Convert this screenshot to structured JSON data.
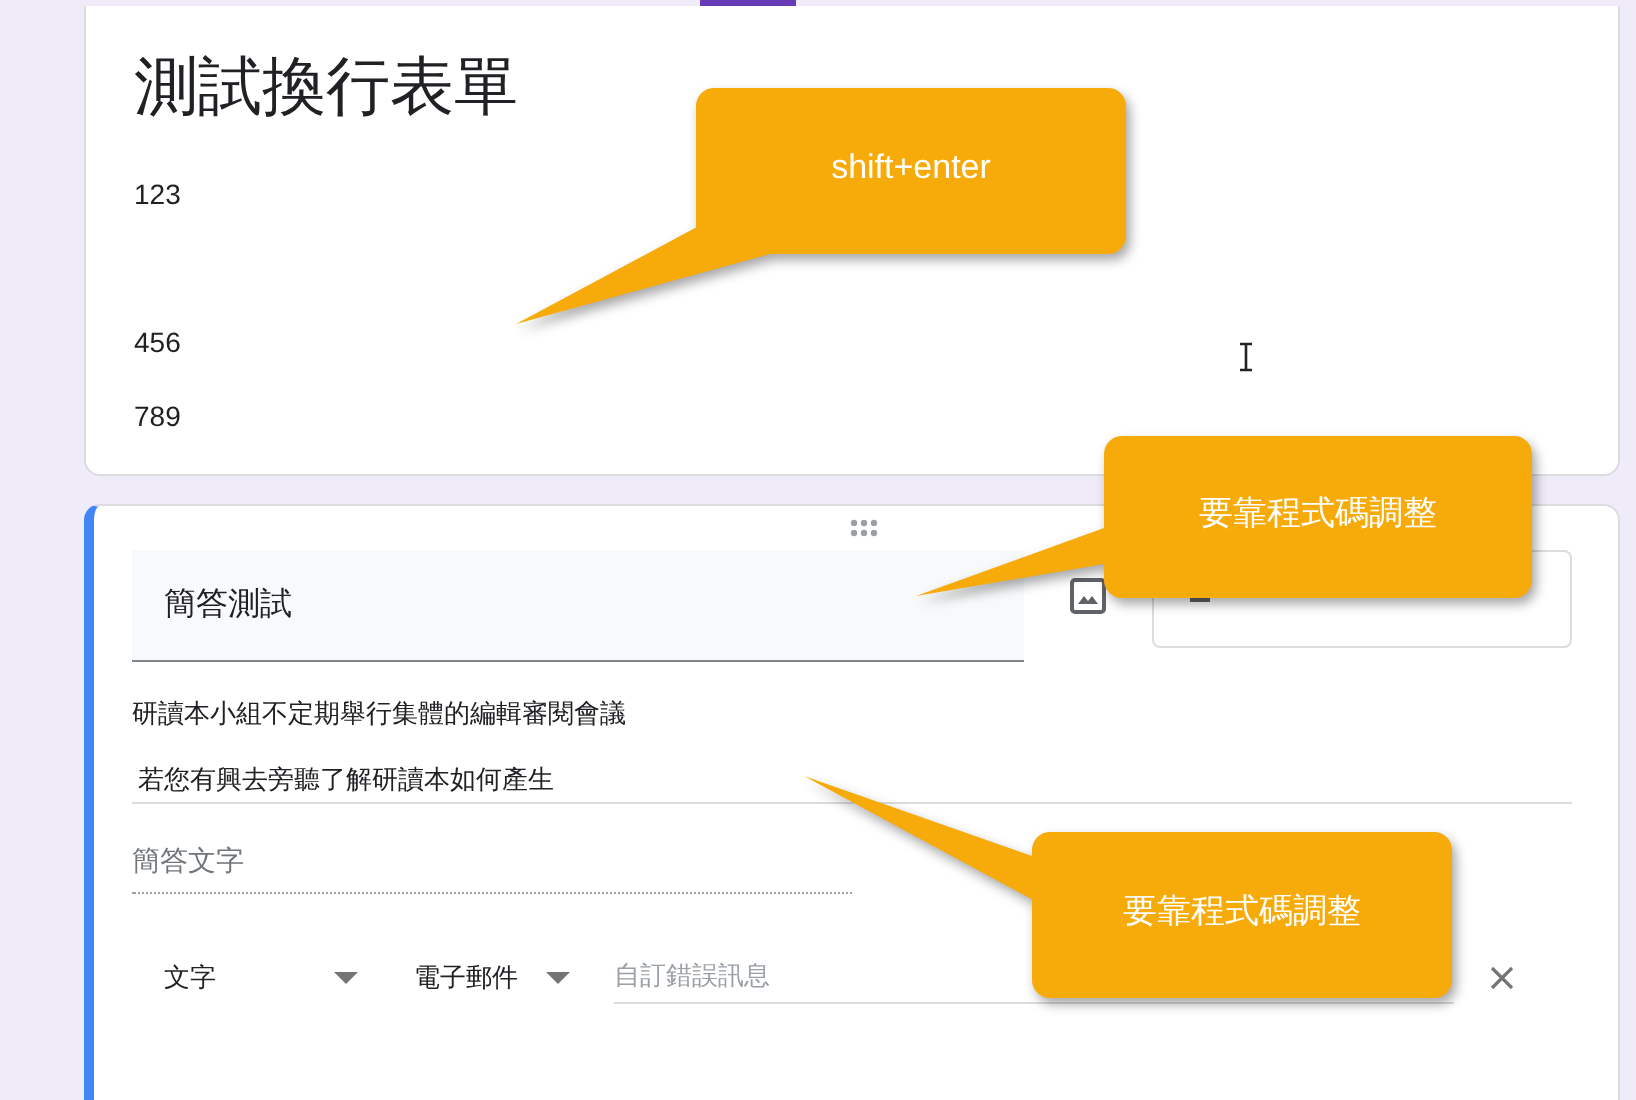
{
  "form_header": {
    "title": "測試換行表單",
    "paragraphs": [
      [
        "123"
      ],
      [
        "456",
        "789"
      ]
    ]
  },
  "question": {
    "title": "簡答測試",
    "description_lines": [
      "研讀本小組不定期舉行集體的編輯審閱會議",
      "若您有興去旁聽了解研讀本如何產生"
    ],
    "answer_placeholder": "簡答文字",
    "validation": {
      "type": "文字",
      "condition": "電子郵件",
      "error_placeholder": "自訂錯誤訊息"
    }
  },
  "callouts": [
    {
      "text": "shift+enter"
    },
    {
      "text": "要靠程式碼調整"
    },
    {
      "text": "要靠程式碼調整"
    }
  ]
}
